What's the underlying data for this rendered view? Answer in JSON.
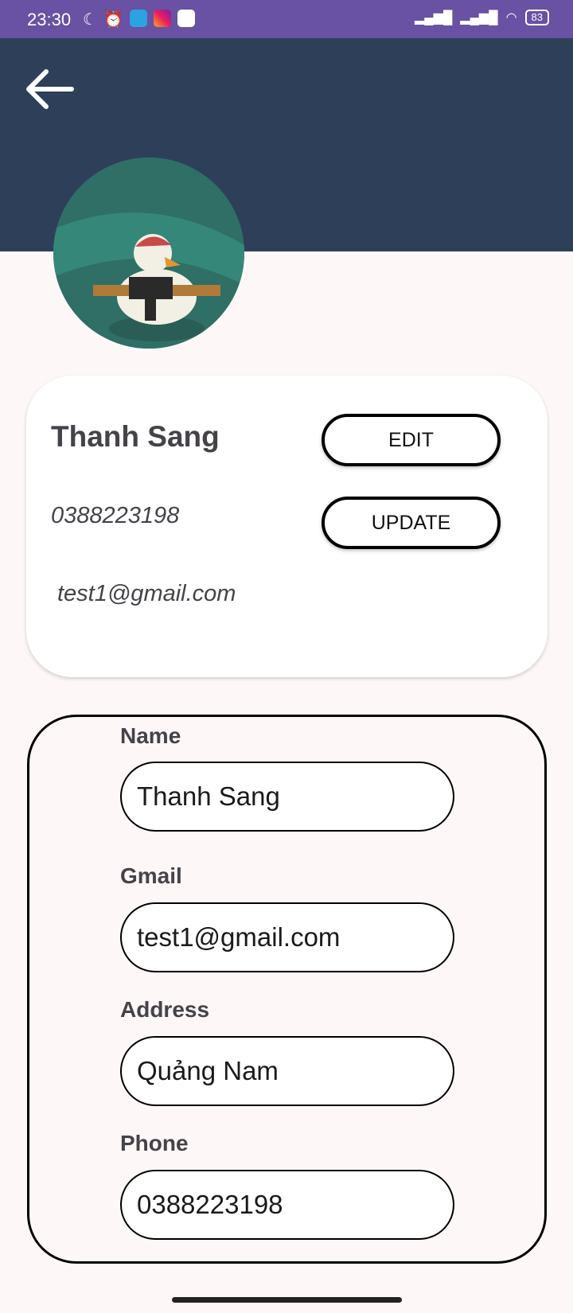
{
  "status_bar": {
    "time": "23:30",
    "battery": "83",
    "icons": [
      "moon-icon",
      "alarm-icon",
      "telegram-icon",
      "instagram-icon",
      "play-icon",
      "signal-icon",
      "signal-icon",
      "wifi-icon",
      "battery-icon"
    ]
  },
  "header": {
    "back_icon": "arrow-left-icon",
    "color": "#2e3f5a"
  },
  "profile": {
    "name": "Thanh Sang",
    "phone": "0388223198",
    "email": "test1@gmail.com",
    "edit_label": "EDIT",
    "update_label": "UPDATE"
  },
  "form": {
    "name_label": "Name",
    "name_value": "Thanh Sang",
    "gmail_label": "Gmail",
    "gmail_value": "test1@gmail.com",
    "address_label": "Address",
    "address_value": "Quảng Nam",
    "phone_label": "Phone",
    "phone_value": "0388223198"
  }
}
